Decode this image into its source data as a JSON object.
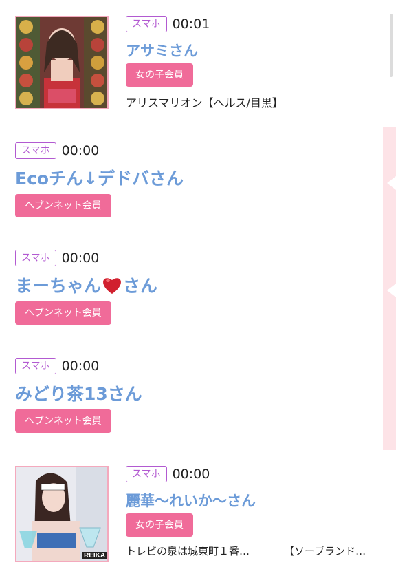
{
  "posts": [
    {
      "device": "スマホ",
      "time": "00:01",
      "name": "アサミさん",
      "member": "女の子会員",
      "desc_left": "アリスマリオン【ヘルス/目黒】",
      "desc_right": ""
    },
    {
      "device": "スマホ",
      "time": "00:00",
      "name": "Ecoチん↓デドバさん",
      "member": "ヘブンネット会員"
    },
    {
      "device": "スマホ",
      "time": "00:00",
      "name_prefix": "まーちゃん",
      "name_suffix": "さん",
      "member": "ヘブンネット会員"
    },
    {
      "device": "スマホ",
      "time": "00:00",
      "name": "みどり茶13さん",
      "member": "ヘブンネット会員"
    },
    {
      "device": "スマホ",
      "time": "00:00",
      "name": "麗華〜れいか〜さん",
      "member": "女の子会員",
      "desc_left": "トレビの泉は城東町１番…",
      "desc_right": "【ソープランド…",
      "photo_caption": "REIKA"
    }
  ],
  "colors": {
    "name_blue": "#6c9bd8",
    "badge_purple": "#b25ad1",
    "member_pink": "#f06b99",
    "side_pink": "#fde3e7"
  }
}
